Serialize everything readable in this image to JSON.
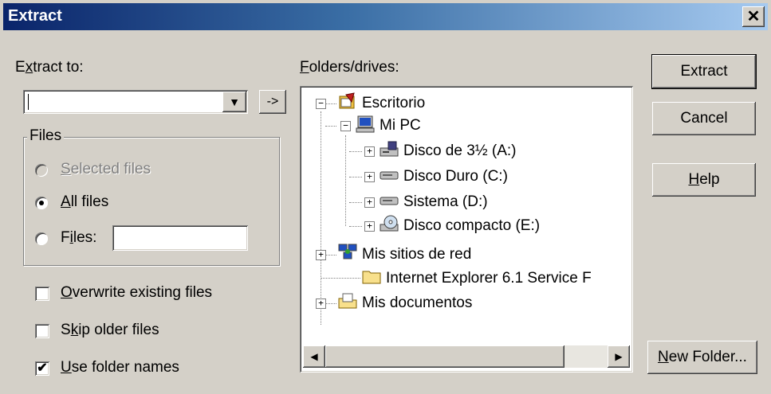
{
  "window": {
    "title": "Extract",
    "close_glyph": "✕"
  },
  "extract_to": {
    "label_pre": "E",
    "label_u": "x",
    "label_post": "tract to:",
    "value": "",
    "dropdown_glyph": "▼",
    "browse_label": "->"
  },
  "files_group": {
    "title": "Files",
    "options": [
      {
        "pre": "",
        "u": "S",
        "post": "elected files",
        "selected": false,
        "disabled": true
      },
      {
        "pre": "",
        "u": "A",
        "post": "ll files",
        "selected": true,
        "disabled": false
      },
      {
        "pre": "F",
        "u": "i",
        "post": "les:",
        "selected": false,
        "disabled": false
      }
    ],
    "files_value": ""
  },
  "checkboxes": [
    {
      "pre": "",
      "u": "O",
      "post": "verwrite existing files",
      "checked": false
    },
    {
      "pre": "S",
      "u": "k",
      "post": "ip older files",
      "checked": false
    },
    {
      "pre": "",
      "u": "U",
      "post": "se folder names",
      "checked": true
    }
  ],
  "folders": {
    "label_pre": "",
    "label_u": "F",
    "label_post": "olders/drives:",
    "tree": [
      {
        "label": "Escritorio",
        "icon": "desktop-icon"
      },
      {
        "label": "Mi PC",
        "icon": "my-computer-icon"
      },
      {
        "label": "Disco de 3½ (A:)",
        "icon": "floppy-drive-icon"
      },
      {
        "label": "Disco Duro (C:)",
        "icon": "hard-drive-icon"
      },
      {
        "label": "Sistema (D:)",
        "icon": "hard-drive-icon"
      },
      {
        "label": "Disco compacto (E:)",
        "icon": "cd-drive-icon"
      },
      {
        "label": "Mis sitios de red",
        "icon": "network-places-icon"
      },
      {
        "label": "Internet Explorer 6.1 Service F",
        "icon": "folder-icon"
      },
      {
        "label": "Mis documentos",
        "icon": "my-documents-icon"
      }
    ],
    "scroll_left": "◀",
    "scroll_right": "▶"
  },
  "buttons": {
    "extract": "Extract",
    "cancel": "Cancel",
    "help_u": "H",
    "help_post": "elp",
    "new_folder_u": "N",
    "new_folder_post": "ew Folder..."
  },
  "colors": {
    "titlebar_start": "#0a246a",
    "titlebar_end": "#a6caf0",
    "face": "#d4d0c8"
  }
}
